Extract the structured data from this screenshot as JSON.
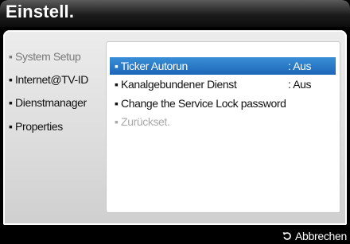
{
  "window": {
    "title": "Einstell."
  },
  "sidebar": {
    "items": [
      {
        "label": "▪ System Setup"
      },
      {
        "label": "▪ Internet@TV-ID"
      },
      {
        "label": "▪ Dienstmanager"
      },
      {
        "label": "▪ Properties"
      }
    ]
  },
  "menu": {
    "items": [
      {
        "label": "▪ Ticker Autorun",
        "value": ": Aus"
      },
      {
        "label": "▪ Kanalgebundener Dienst",
        "value": ": Aus"
      },
      {
        "label": "▪ Change the Service Lock password",
        "value": ""
      },
      {
        "label": "▪ Zurückset.",
        "value": ""
      }
    ]
  },
  "footer": {
    "cancel_label": "Abbrechen",
    "cancel_icon": "return-arrow-icon"
  },
  "colors": {
    "selection": "#2a7bc8",
    "panel": "#e3e3e3",
    "titlebar": "#222222"
  }
}
